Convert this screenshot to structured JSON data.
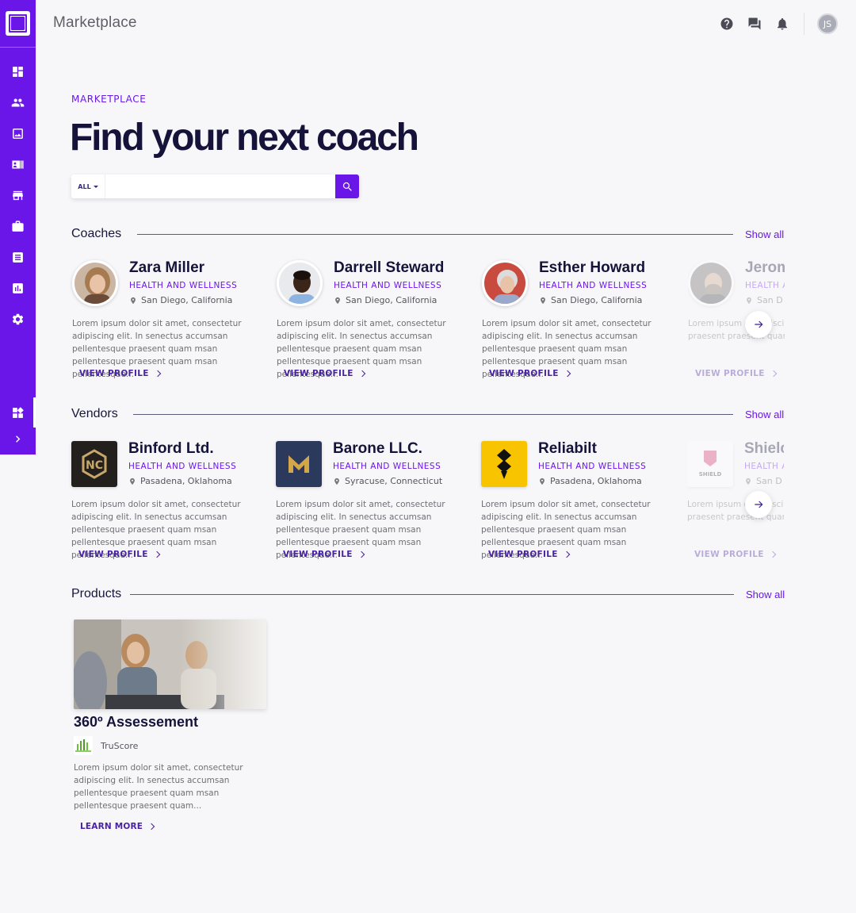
{
  "header": {
    "title": "Marketplace",
    "avatar_initials": "JS",
    "icons": [
      "help-icon",
      "chat-icon",
      "bell-icon"
    ]
  },
  "sidebar": {
    "items": [
      "dashboard-icon",
      "people-icon",
      "image-icon",
      "contacts-icon",
      "store-icon",
      "briefcase-icon",
      "list-icon",
      "chart-icon",
      "gear-icon",
      "widgets-icon",
      "chevron-right-icon"
    ],
    "accent": "#6a16e8"
  },
  "hero": {
    "eyebrow": "MARKETPLACE",
    "title": "Find your next coach",
    "search_scope": "ALL",
    "search_placeholder": ""
  },
  "sections": {
    "coaches": {
      "title": "Coaches",
      "show_all": "Show all",
      "cards": [
        {
          "name": "Zara Miller",
          "category": "HEALTH AND WELLNESS",
          "location": "San Diego, California",
          "description": "Lorem ipsum dolor sit amet, consectetur adipiscing elit. In senectus accumsan pellentesque praesent quam msan pellentesque praesent quam msan pellentesque...",
          "cta": "VIEW PROFILE"
        },
        {
          "name": "Darrell Steward",
          "category": "HEALTH AND WELLNESS",
          "location": "San Diego, California",
          "description": "Lorem ipsum dolor sit amet, consectetur adipiscing elit. In senectus accumsan pellentesque praesent quam msan pellentesque praesent quam msan pellentesque...",
          "cta": "VIEW PROFILE"
        },
        {
          "name": "Esther Howard",
          "category": "HEALTH AND WELLNESS",
          "location": "San Diego, California",
          "description": "Lorem ipsum dolor sit amet, consectetur adipiscing elit. In senectus accumsan pellentesque praesent quam msan pellentesque praesent quam msan pellentesque...",
          "cta": "VIEW PROFILE"
        },
        {
          "name": "Jerom",
          "category": "HEALTH A",
          "location": "San D",
          "description": "Lorem ipsum d adipiscing elit. pellentesque praesent praesent quam msan p",
          "cta": "VIEW PROFILE"
        }
      ]
    },
    "vendors": {
      "title": "Vendors",
      "show_all": "Show all",
      "cards": [
        {
          "name": "Binford Ltd.",
          "category": "HEALTH AND WELLNESS",
          "location": "Pasadena, Oklahoma",
          "description": "Lorem ipsum dolor sit amet, consectetur adipiscing elit. In senectus accumsan pellentesque praesent quam msan pellentesque praesent quam msan pellentesque...",
          "cta": "VIEW PROFILE"
        },
        {
          "name": "Barone LLC.",
          "category": "HEALTH AND WELLNESS",
          "location": "Syracuse, Connecticut",
          "description": "Lorem ipsum dolor sit amet, consectetur adipiscing elit. In senectus accumsan pellentesque praesent quam msan pellentesque praesent quam msan pellentesque...",
          "cta": "VIEW PROFILE"
        },
        {
          "name": "Reliabilt",
          "category": "HEALTH AND WELLNESS",
          "location": "Pasadena, Oklahoma",
          "description": "Lorem ipsum dolor sit amet, consectetur adipiscing elit. In senectus accumsan pellentesque praesent quam msan pellentesque praesent quam msan pellentesque...",
          "cta": "VIEW PROFILE"
        },
        {
          "name": "Shielc",
          "category": "HEALTH A",
          "location": "San D",
          "logo_text": "SHIELD",
          "description": "Lorem ipsum d adipiscing elit. pellentesque praesent praesent quam msan p",
          "cta": "VIEW PROFILE"
        }
      ]
    },
    "products": {
      "title": "Products",
      "show_all": "Show all",
      "items": [
        {
          "title": "360º Assessement",
          "vendor": "TruScore",
          "description": "Lorem ipsum dolor sit amet, consectetur adipiscing elit. In senectus accumsan pellentesque praesent quam msan pellentesque praesent quam...",
          "cta": "LEARN MORE"
        }
      ]
    }
  }
}
